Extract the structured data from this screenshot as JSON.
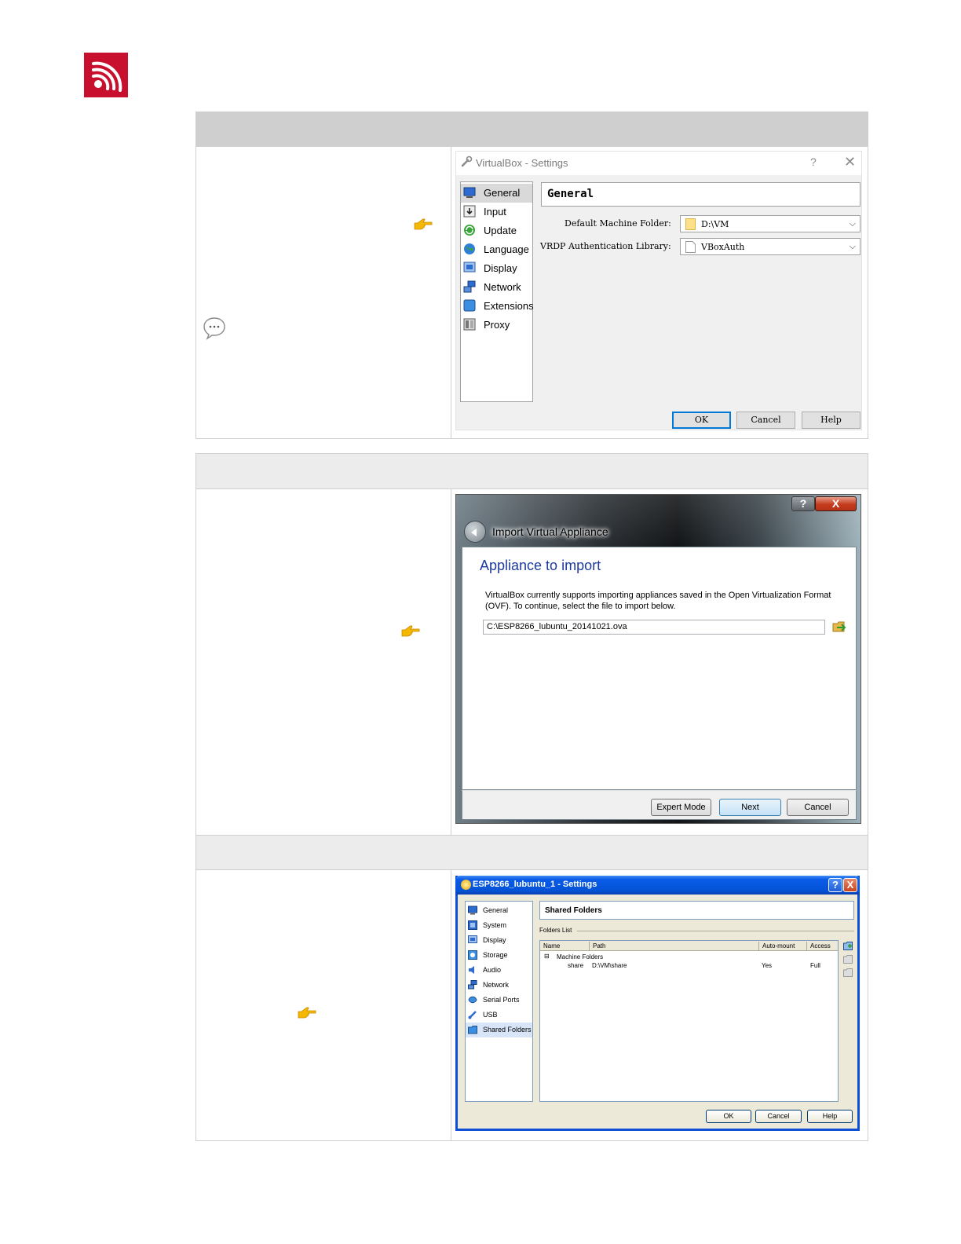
{
  "logo": {
    "brand_color": "#c8102e",
    "icon": "espressif-logo"
  },
  "decorations": {
    "pointer_icon": "pointing-hand-icon",
    "note_icon": "speech-bubble-icon",
    "pointer_color": "#f5b800"
  },
  "window1": {
    "title": "VirtualBox - Settings",
    "help_glyph": "?",
    "close_glyph": "✕",
    "sidebar": [
      {
        "label": "General",
        "icon": "general-icon"
      },
      {
        "label": "Input",
        "icon": "input-icon"
      },
      {
        "label": "Update",
        "icon": "update-icon"
      },
      {
        "label": "Language",
        "icon": "language-icon"
      },
      {
        "label": "Display",
        "icon": "display-icon"
      },
      {
        "label": "Network",
        "icon": "network-icon"
      },
      {
        "label": "Extensions",
        "icon": "extensions-icon"
      },
      {
        "label": "Proxy",
        "icon": "proxy-icon"
      }
    ],
    "selected": "General",
    "panel_title": "General",
    "fields": {
      "machine_folder_label": "Default Machine Folder:",
      "machine_folder_value": "D:\\VM",
      "vrdp_label": "VRDP Authentication Library:",
      "vrdp_value": "VBoxAuth"
    },
    "buttons": {
      "ok": "OK",
      "cancel": "Cancel",
      "help": "Help"
    }
  },
  "window2": {
    "help_glyph": "?",
    "close_glyph": "X",
    "title": "Import Virtual Appliance",
    "heading": "Appliance to import",
    "description": "VirtualBox currently supports importing appliances saved in the Open Virtualization Format (OVF). To continue, select the file to import below.",
    "file_path": "C:\\ESP8266_lubuntu_20141021.ova",
    "buttons": {
      "expert": "Expert Mode",
      "next": "Next",
      "cancel": "Cancel"
    }
  },
  "window3": {
    "title": "ESP8266_lubuntu_1 - Settings",
    "help_glyph": "?",
    "close_glyph": "X",
    "sidebar": [
      {
        "label": "General",
        "icon": "general-icon"
      },
      {
        "label": "System",
        "icon": "system-icon"
      },
      {
        "label": "Display",
        "icon": "display-icon"
      },
      {
        "label": "Storage",
        "icon": "storage-icon"
      },
      {
        "label": "Audio",
        "icon": "audio-icon"
      },
      {
        "label": "Network",
        "icon": "network-icon"
      },
      {
        "label": "Serial Ports",
        "icon": "serial-ports-icon"
      },
      {
        "label": "USB",
        "icon": "usb-icon"
      },
      {
        "label": "Shared Folders",
        "icon": "shared-folders-icon"
      }
    ],
    "selected": "Shared Folders",
    "panel_title": "Shared Folders",
    "folders_list_label": "Folders List",
    "columns": [
      "Name",
      "Path",
      "Auto-mount",
      "Access"
    ],
    "group_toggle": "⊟",
    "group": "Machine Folders",
    "rows": [
      {
        "name": "share",
        "path": "D:\\VM\\share",
        "auto_mount": "Yes",
        "access": "Full"
      }
    ],
    "buttons": {
      "ok": "OK",
      "cancel": "Cancel",
      "help": "Help"
    }
  }
}
